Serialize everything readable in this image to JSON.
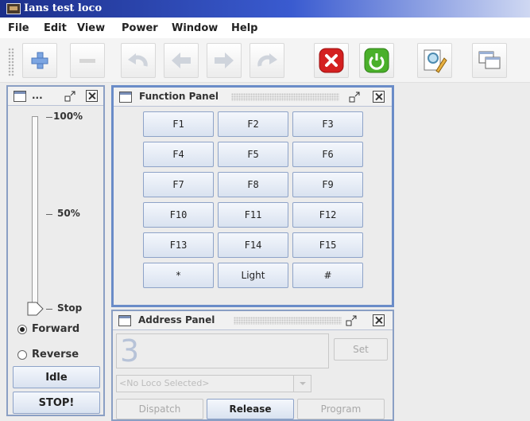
{
  "window": {
    "title": "Ians test loco"
  },
  "menu": [
    "File",
    "Edit",
    "View",
    "Power",
    "Window",
    "Help"
  ],
  "toolbar": {
    "buttons": [
      "add-icon",
      "remove-icon",
      "undo-icon",
      "arrow-left-icon",
      "arrow-right-icon",
      "redo-icon",
      "stop-icon",
      "power-icon",
      "edit-icon",
      "windows-icon"
    ]
  },
  "throttle": {
    "title": "...",
    "ticks": {
      "max": "100%",
      "mid": "50%",
      "min": "Stop"
    },
    "direction": {
      "forward": "Forward",
      "reverse": "Reverse",
      "selected": "Forward"
    },
    "idle_label": "Idle",
    "stop_label": "STOP!"
  },
  "function_panel": {
    "title": "Function Panel",
    "buttons": [
      "F1",
      "F2",
      "F3",
      "F4",
      "F5",
      "F6",
      "F7",
      "F8",
      "F9",
      "F10",
      "F11",
      "F12",
      "F13",
      "F14",
      "F15",
      "*",
      "Light",
      "#"
    ]
  },
  "address_panel": {
    "title": "Address Panel",
    "address_value": "3",
    "set_label": "Set",
    "loco_placeholder": "<No Loco Selected>",
    "dispatch_label": "Dispatch",
    "release_label": "Release",
    "program_label": "Program"
  },
  "colors": {
    "title_bar": "#1c2f8a",
    "frame_border": "#6a8cc8",
    "stop_red": "#d42020",
    "power_green": "#4ab02a"
  }
}
